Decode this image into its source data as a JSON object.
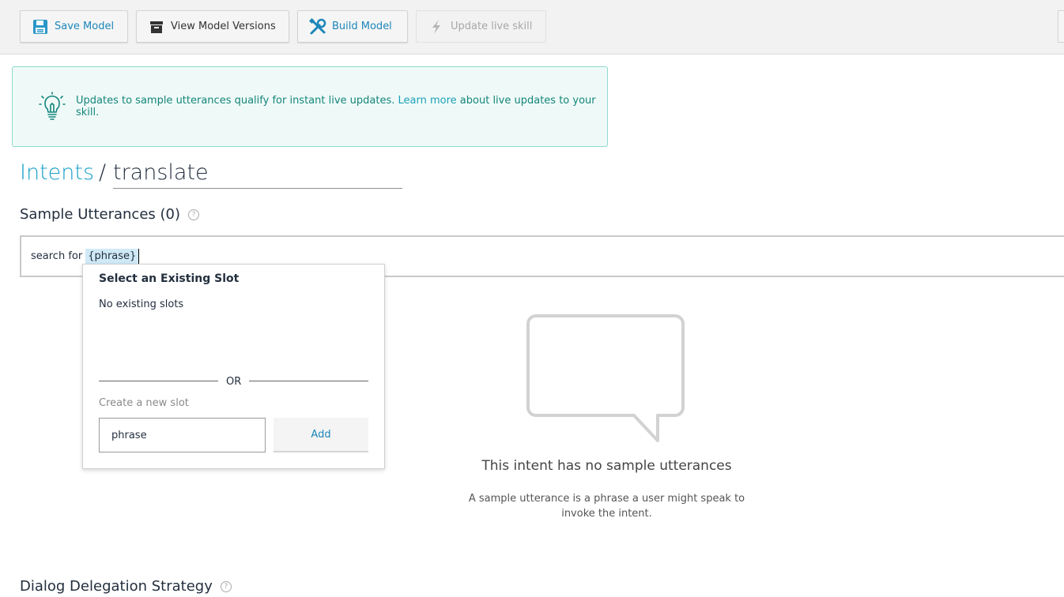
{
  "toolbar": {
    "save_label": "Save Model",
    "versions_label": "View Model Versions",
    "build_label": "Build Model",
    "update_label": "Update live skill"
  },
  "banner": {
    "text_before": "Updates to sample utterances qualify for instant live updates.",
    "link": "Learn more",
    "text_after": "about live updates to your skill."
  },
  "breadcrumb": {
    "root": "Intents",
    "separator": "/",
    "intent_name": "translate"
  },
  "utterances": {
    "title": "Sample Utterances (0)",
    "help": "?",
    "input_text": "search for",
    "slot_token": "{phrase}"
  },
  "slot_popup": {
    "title": "Select an Existing Slot",
    "no_slots": "No existing slots",
    "or_label": "OR",
    "create_label": "Create a new slot",
    "new_slot_value": "phrase",
    "add_label": "Add"
  },
  "empty_state": {
    "title": "This intent has no sample utterances",
    "desc_line1": "A sample utterance is a phrase a user might speak to",
    "desc_line2": "invoke the intent."
  },
  "dialog": {
    "title": "Dialog Delegation Strategy",
    "help": "?"
  },
  "colors": {
    "accent": "#1aa0c8",
    "banner_bg": "#effaf8",
    "banner_border": "#8fd9cb"
  }
}
